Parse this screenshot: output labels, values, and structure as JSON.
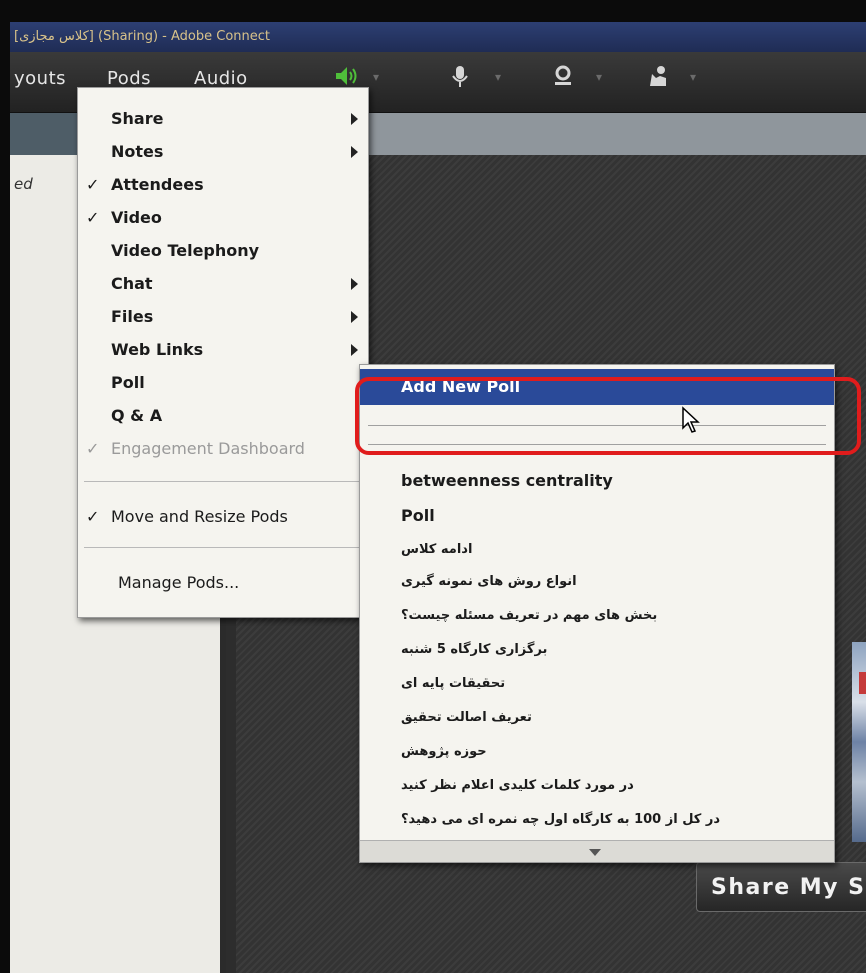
{
  "window": {
    "title": "[کلاس مجازی] (Sharing) - Adobe Connect"
  },
  "menubar": {
    "items": [
      "youts",
      "Pods",
      "Audio"
    ],
    "icons": [
      "speaker-icon",
      "microphone-icon",
      "webcam-icon",
      "raise-hand-icon"
    ]
  },
  "left_pod": {
    "text": "ed"
  },
  "pods_menu": {
    "items": [
      {
        "label": "Share",
        "checked": false,
        "submenu": true
      },
      {
        "label": "Notes",
        "checked": false,
        "submenu": true
      },
      {
        "label": "Attendees",
        "checked": true,
        "submenu": false
      },
      {
        "label": "Video",
        "checked": true,
        "submenu": false
      },
      {
        "label": "Video Telephony",
        "checked": false,
        "submenu": false
      },
      {
        "label": "Chat",
        "checked": false,
        "submenu": true
      },
      {
        "label": "Files",
        "checked": false,
        "submenu": true
      },
      {
        "label": "Web Links",
        "checked": false,
        "submenu": true
      },
      {
        "label": "Poll",
        "checked": false,
        "submenu": true
      },
      {
        "label": "Q & A",
        "checked": false,
        "submenu": false
      },
      {
        "label": "Engagement Dashboard",
        "checked": true,
        "submenu": false,
        "disabled": true
      }
    ],
    "move_resize": "Move and Resize Pods",
    "manage": "Manage Pods...",
    "check_mark": "✓"
  },
  "poll_menu": {
    "add_new": "Add New Poll",
    "items": [
      "betweenness centrality",
      "Poll",
      "ادامه کلاس",
      "انواع روش های نمونه گیری",
      "بخش های مهم در تعریف مسئله چیست؟",
      "برگزاری کارگاه 5 شنبه",
      "تحقیقات پایه ای",
      "تعریف اصالت تحقیق",
      "حوزه پژوهش",
      "در مورد کلمات کلیدی اعلام نظر کنید",
      "در کل از 100 به کارگاه اول چه نمره ای می دهید؟"
    ]
  },
  "stage": {
    "share_button": "Share My S"
  },
  "colors": {
    "highlight": "#2a4a99",
    "annotation": "#e01c1c"
  }
}
